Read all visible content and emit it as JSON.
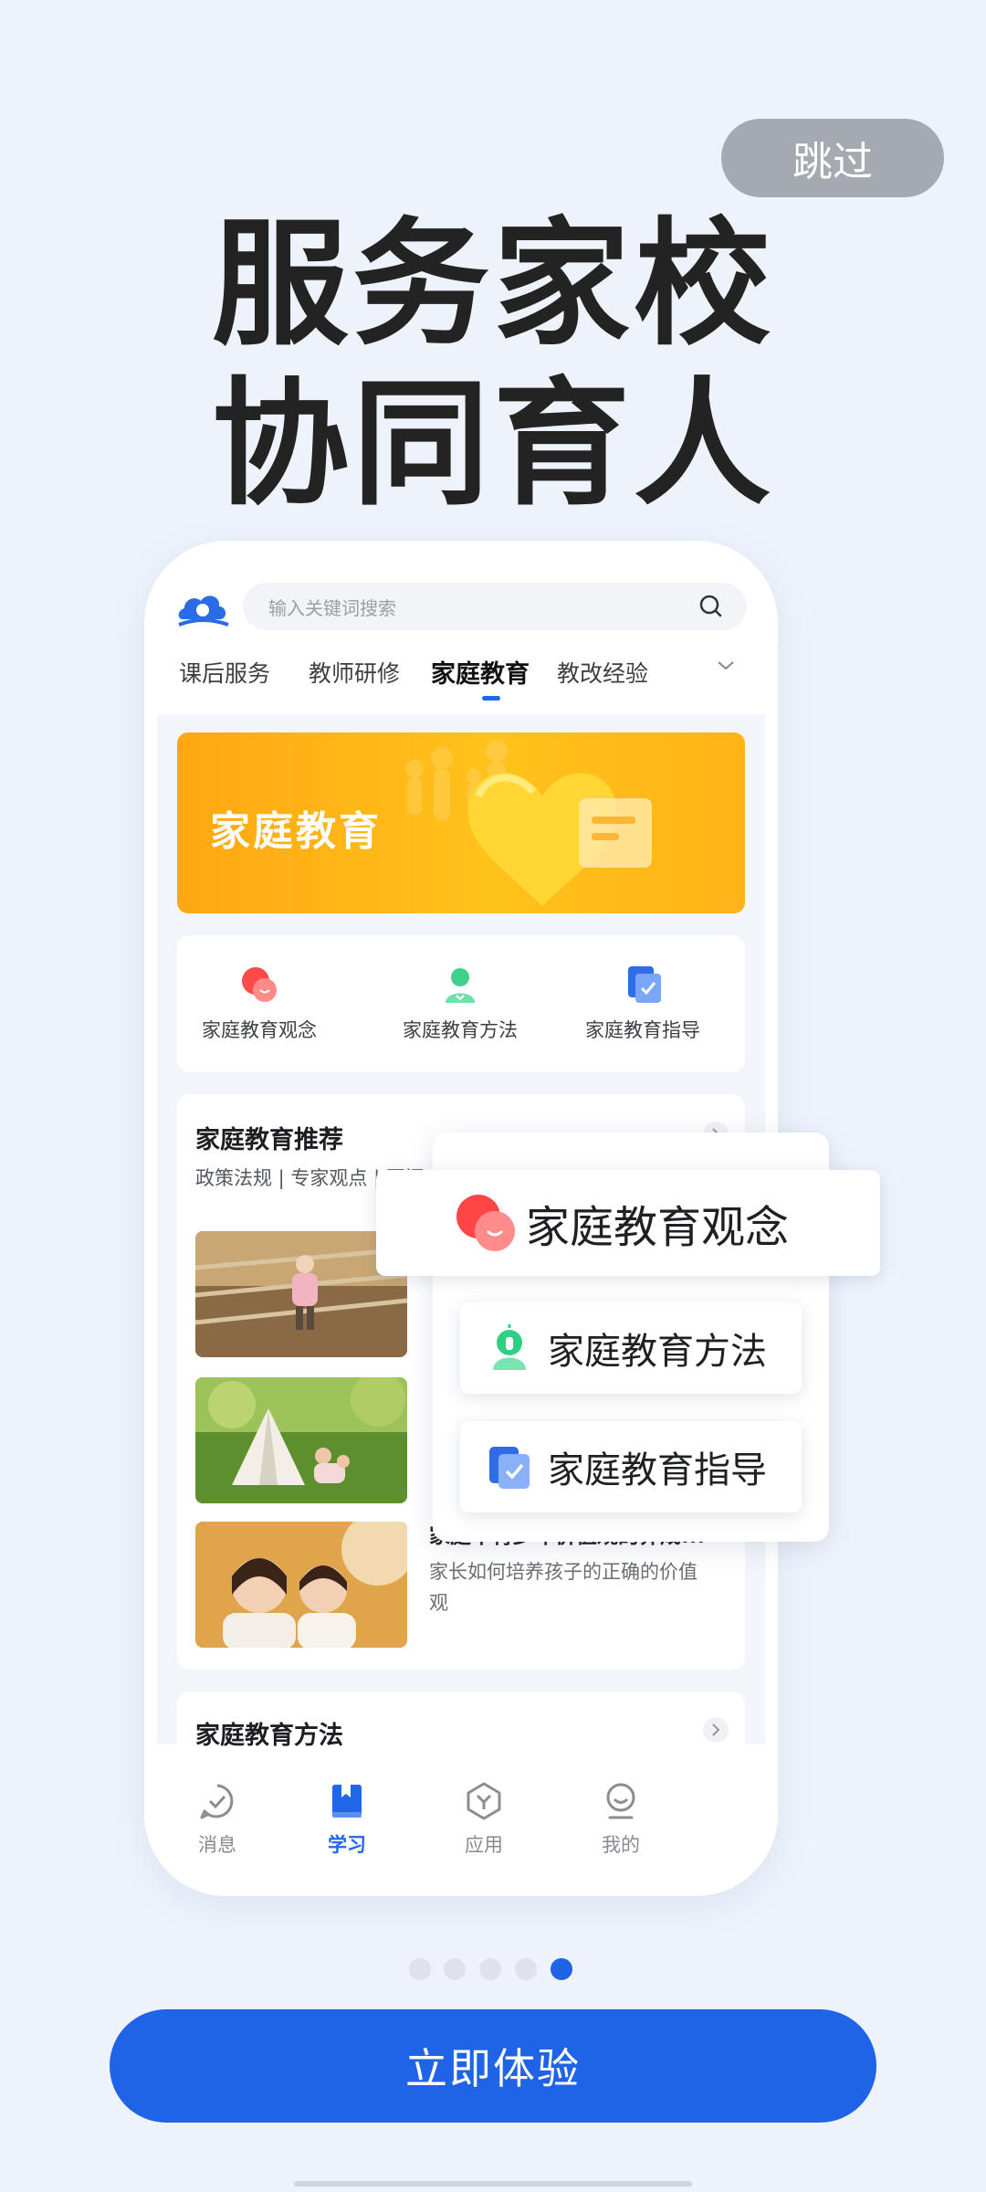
{
  "skip_label": "跳过",
  "headline": {
    "line1": "服务家校",
    "line2": "协同育人"
  },
  "app": {
    "search_placeholder": "输入关键词搜索",
    "tabs": [
      {
        "label": "课后服务"
      },
      {
        "label": "教师研修"
      },
      {
        "label": "家庭教育",
        "active": true
      },
      {
        "label": "教改经验"
      }
    ],
    "banner_text": "家庭教育",
    "quick_links": [
      {
        "label": "家庭教育观念",
        "icon": "chat-bubble-icon"
      },
      {
        "label": "家庭教育方法",
        "icon": "lightbulb-icon"
      },
      {
        "label": "家庭教育指导",
        "icon": "clipboard-check-icon"
      }
    ],
    "recommend": {
      "title": "家庭教育推荐",
      "subtitle": "政策法规 | 专家观点 | 要闻",
      "articles": [
        {
          "title": "家庭中青少年价值观的养成...",
          "desc": "家长如何培养孩子的正确的价值观"
        }
      ]
    },
    "method_section_title": "家庭教育方法",
    "bottom_nav": [
      {
        "label": "消息",
        "icon": "message-check-icon"
      },
      {
        "label": "学习",
        "icon": "book-icon",
        "active": true
      },
      {
        "label": "应用",
        "icon": "app-hex-icon"
      },
      {
        "label": "我的",
        "icon": "user-icon"
      }
    ]
  },
  "overlay": {
    "items": [
      {
        "label": "家庭教育观念"
      },
      {
        "label": "家庭教育方法"
      },
      {
        "label": "家庭教育指导"
      }
    ]
  },
  "pagination": {
    "count": 5,
    "active_index": 4
  },
  "cta_label": "立即体验",
  "colors": {
    "primary": "#1f63e6",
    "background": "#eef3fb",
    "banner": "#ffb317"
  }
}
